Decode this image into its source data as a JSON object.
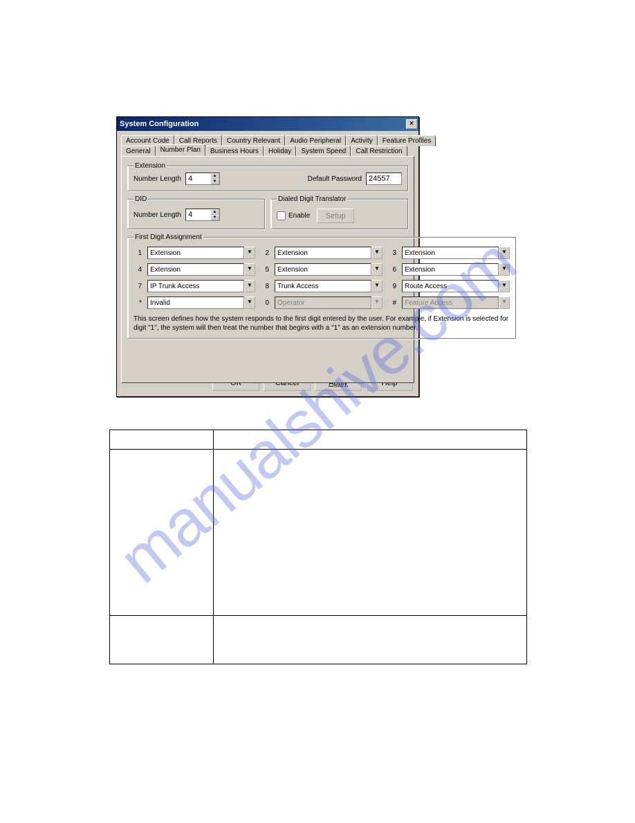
{
  "watermark": "manualshive.com",
  "dialog": {
    "title": "System Configuration",
    "close_glyph": "×",
    "tabs_row1": [
      "Account Code",
      "Call Reports",
      "Country Relevant",
      "Audio Peripheral",
      "Activity",
      "Feature Profiles"
    ],
    "tabs_row2": [
      "General",
      "Number Plan",
      "Business Hours",
      "Holiday",
      "System Speed",
      "Call Restriction"
    ],
    "active_tab": "Number Plan"
  },
  "extension": {
    "legend": "Extension",
    "number_length_label": "Number Length",
    "number_length_value": "4",
    "default_password_label": "Default Password",
    "default_password_value": "24557"
  },
  "did": {
    "legend": "DID",
    "number_length_label": "Number Length",
    "number_length_value": "4"
  },
  "ddt": {
    "legend": "Dialed Digit Translator",
    "enable_label": "Enable",
    "enable_checked": false,
    "setup_label": "Setup"
  },
  "fda": {
    "legend": "First Digit Assignment",
    "digits": [
      {
        "d": "1",
        "v": "Extension",
        "enabled": true
      },
      {
        "d": "2",
        "v": "Extension",
        "enabled": true
      },
      {
        "d": "3",
        "v": "Extension",
        "enabled": true
      },
      {
        "d": "4",
        "v": "Extension",
        "enabled": true
      },
      {
        "d": "5",
        "v": "Extension",
        "enabled": true
      },
      {
        "d": "6",
        "v": "Extension",
        "enabled": true
      },
      {
        "d": "7",
        "v": "IP Trunk Access",
        "enabled": true
      },
      {
        "d": "8",
        "v": "Trunk Access",
        "enabled": true
      },
      {
        "d": "9",
        "v": "Route Access",
        "enabled": true
      },
      {
        "d": "*",
        "v": "Invalid",
        "enabled": true
      },
      {
        "d": "0",
        "v": "Operator",
        "enabled": false
      },
      {
        "d": "#",
        "v": "Feature Access",
        "enabled": false
      }
    ],
    "help": "This screen defines how the system responds to the first digit entered by the user. For example, if Extension is selected for digit \"1\", the system will then treat the number that begins with a \"1\" as an extension number."
  },
  "buttons": {
    "ok": "OK",
    "cancel": "Cancel",
    "apply": "Apply",
    "help": "Help"
  },
  "glyphs": {
    "up": "▲",
    "down": "▼",
    "dropdown": "▼"
  }
}
